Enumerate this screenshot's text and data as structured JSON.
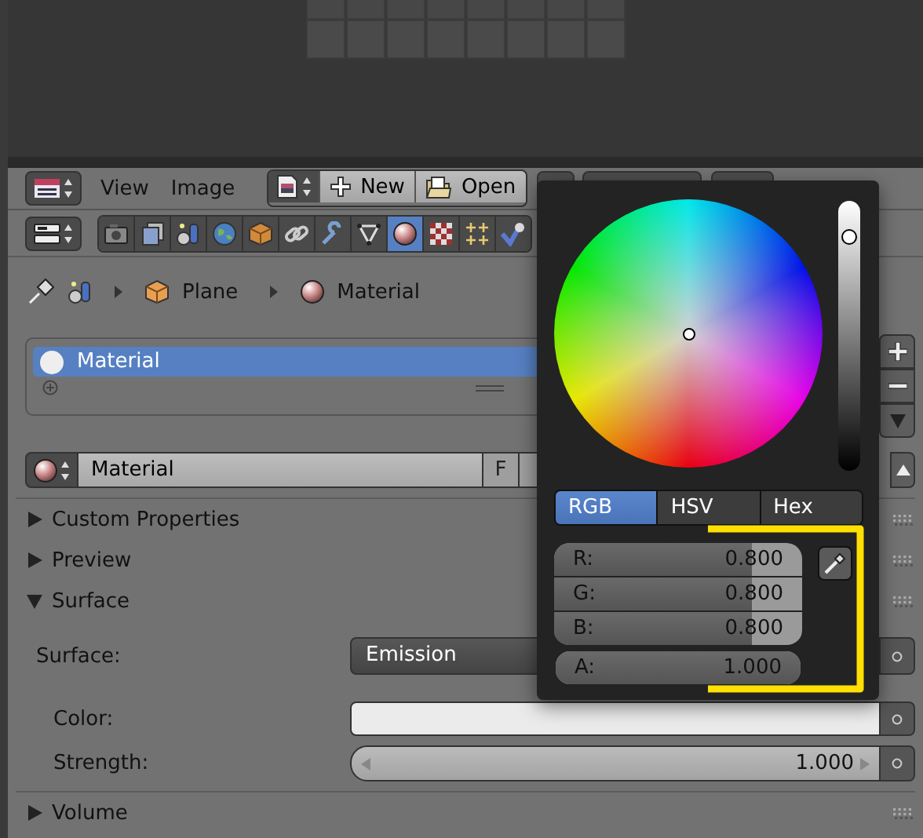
{
  "header": {
    "menus": [
      "View",
      "Image"
    ],
    "buttons": [
      {
        "label": "New",
        "kind": "new"
      },
      {
        "label": "Open",
        "kind": "open"
      }
    ]
  },
  "property_tabs": [
    {
      "kind": "render",
      "selected": false
    },
    {
      "kind": "layers",
      "selected": false
    },
    {
      "kind": "scene",
      "selected": false
    },
    {
      "kind": "world",
      "selected": false
    },
    {
      "kind": "object",
      "selected": false
    },
    {
      "kind": "constraints",
      "selected": false
    },
    {
      "kind": "modifiers",
      "selected": false
    },
    {
      "kind": "data",
      "selected": false
    },
    {
      "kind": "material",
      "selected": true
    },
    {
      "kind": "texture",
      "selected": false
    },
    {
      "kind": "particles",
      "selected": false
    },
    {
      "kind": "physics",
      "selected": false
    }
  ],
  "breadcrumb": [
    {
      "label": "Plane",
      "kind": "object"
    },
    {
      "label": "Material",
      "kind": "material"
    }
  ],
  "material_slots": [
    {
      "name": "Material",
      "selected": true
    }
  ],
  "material_datablock": {
    "name": "Material",
    "fake_user": "F"
  },
  "panels": [
    {
      "title": "Custom Properties",
      "expanded": false
    },
    {
      "title": "Preview",
      "expanded": false
    },
    {
      "title": "Surface",
      "expanded": true,
      "fields": [
        {
          "label": "Surface:",
          "kind": "dropdown",
          "value": "Emission"
        },
        {
          "label": "Color:",
          "kind": "color",
          "color": "#ebebeb"
        },
        {
          "label": "Strength:",
          "kind": "slider",
          "value": "1.000"
        }
      ]
    },
    {
      "title": "Volume",
      "expanded": false
    }
  ],
  "color_picker": {
    "value_slider": {
      "level": 0.9
    },
    "modes": [
      {
        "label": "RGB",
        "selected": true
      },
      {
        "label": "HSV",
        "selected": false
      },
      {
        "label": "Hex",
        "selected": false
      }
    ],
    "channels": [
      {
        "label": "R:",
        "value": "0.800",
        "level": 0.8
      },
      {
        "label": "G:",
        "value": "0.800",
        "level": 0.8
      },
      {
        "label": "B:",
        "value": "0.800",
        "level": 0.8
      },
      {
        "label": "A:",
        "value": "1.000",
        "level": 1
      }
    ]
  }
}
